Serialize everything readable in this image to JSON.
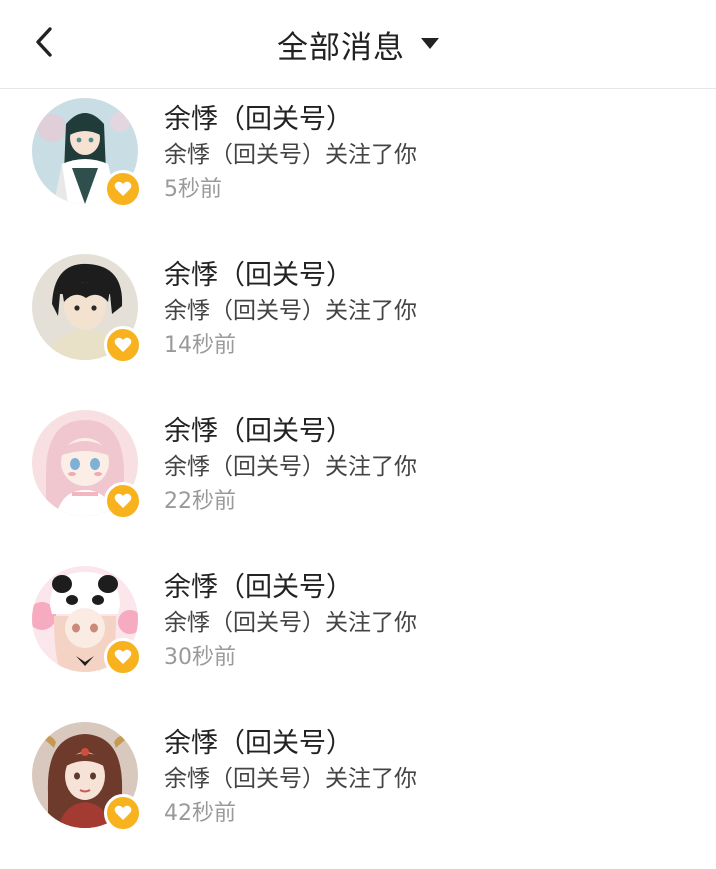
{
  "header": {
    "title": "全部消息"
  },
  "colors": {
    "badge": "#f7b21d",
    "title": "#222222",
    "time": "#9a9a9a"
  },
  "notifications": [
    {
      "name": "余悸（回关号）",
      "desc": "余悸（回关号）关注了你",
      "time": "5秒前",
      "icon": "heart-icon"
    },
    {
      "name": "余悸（回关号）",
      "desc": "余悸（回关号）关注了你",
      "time": "14秒前",
      "icon": "heart-icon"
    },
    {
      "name": "余悸（回关号）",
      "desc": "余悸（回关号）关注了你",
      "time": "22秒前",
      "icon": "heart-icon"
    },
    {
      "name": "余悸（回关号）",
      "desc": "余悸（回关号）关注了你",
      "time": "30秒前",
      "icon": "heart-icon"
    },
    {
      "name": "余悸（回关号）",
      "desc": "余悸（回关号）关注了你",
      "time": "42秒前",
      "icon": "heart-icon"
    }
  ]
}
